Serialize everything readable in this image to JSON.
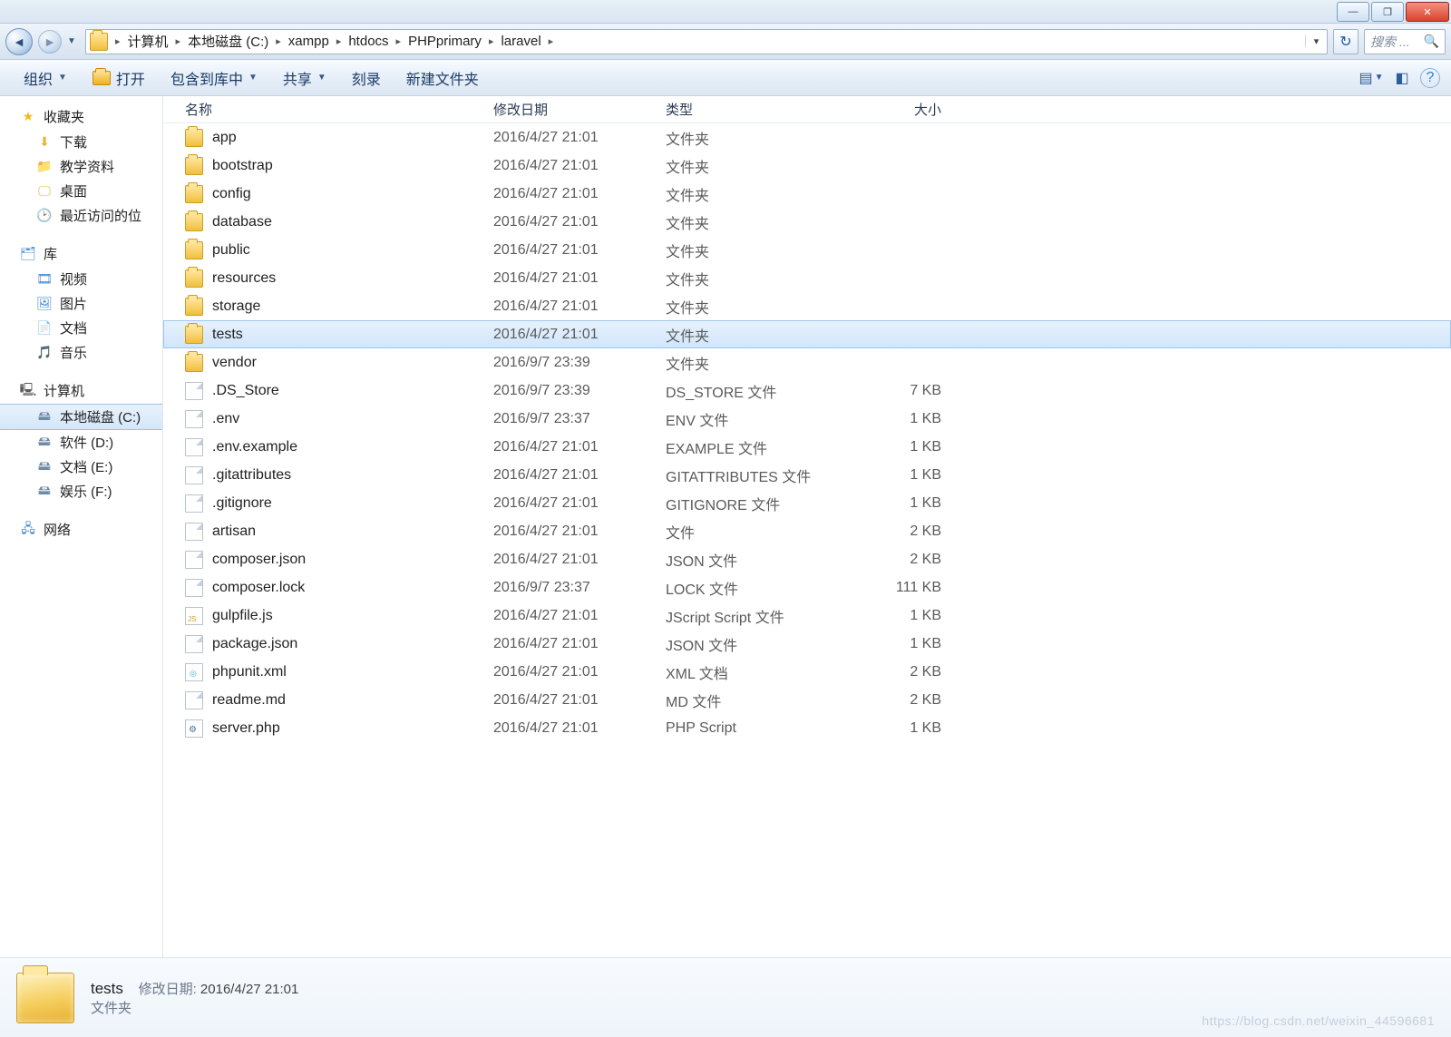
{
  "titlebar": {
    "min": "—",
    "max": "❐",
    "close": "✕"
  },
  "address": {
    "back": "◄",
    "fwd": "►",
    "history_drop": "▼",
    "crumbs": [
      "计算机",
      "本地磁盘 (C:)",
      "xampp",
      "htdocs",
      "PHPprimary",
      "laravel"
    ],
    "sep": "▸",
    "path_drop": "▾",
    "refresh": "↻",
    "search_placeholder": "搜索 ...",
    "search_icon": "🔍"
  },
  "toolbar": {
    "organize": "组织",
    "open": "打开",
    "include": "包含到库中",
    "share": "共享",
    "burn": "刻录",
    "newfolder": "新建文件夹",
    "view_icon": "▤",
    "preview_icon": "◧",
    "help_icon": "?"
  },
  "nav": {
    "favorites": "收藏夹",
    "fav_items": [
      "下载",
      "教学资料",
      "桌面",
      "最近访问的位"
    ],
    "libraries": "库",
    "lib_items": [
      "视频",
      "图片",
      "文档",
      "音乐"
    ],
    "computer": "计算机",
    "drives": [
      "本地磁盘 (C:)",
      "软件 (D:)",
      "文档 (E:)",
      "娱乐 (F:)"
    ],
    "selected_drive_index": 0,
    "network": "网络"
  },
  "columns": {
    "name": "名称",
    "date": "修改日期",
    "type": "类型",
    "size": "大小"
  },
  "files": [
    {
      "name": "app",
      "date": "2016/4/27 21:01",
      "type": "文件夹",
      "size": "",
      "icon": "folder"
    },
    {
      "name": "bootstrap",
      "date": "2016/4/27 21:01",
      "type": "文件夹",
      "size": "",
      "icon": "folder"
    },
    {
      "name": "config",
      "date": "2016/4/27 21:01",
      "type": "文件夹",
      "size": "",
      "icon": "folder"
    },
    {
      "name": "database",
      "date": "2016/4/27 21:01",
      "type": "文件夹",
      "size": "",
      "icon": "folder"
    },
    {
      "name": "public",
      "date": "2016/4/27 21:01",
      "type": "文件夹",
      "size": "",
      "icon": "folder"
    },
    {
      "name": "resources",
      "date": "2016/4/27 21:01",
      "type": "文件夹",
      "size": "",
      "icon": "folder"
    },
    {
      "name": "storage",
      "date": "2016/4/27 21:01",
      "type": "文件夹",
      "size": "",
      "icon": "folder"
    },
    {
      "name": "tests",
      "date": "2016/4/27 21:01",
      "type": "文件夹",
      "size": "",
      "icon": "folder",
      "selected": true
    },
    {
      "name": "vendor",
      "date": "2016/9/7 23:39",
      "type": "文件夹",
      "size": "",
      "icon": "folder"
    },
    {
      "name": ".DS_Store",
      "date": "2016/9/7 23:39",
      "type": "DS_STORE 文件",
      "size": "7 KB",
      "icon": "file"
    },
    {
      "name": ".env",
      "date": "2016/9/7 23:37",
      "type": "ENV 文件",
      "size": "1 KB",
      "icon": "file"
    },
    {
      "name": ".env.example",
      "date": "2016/4/27 21:01",
      "type": "EXAMPLE 文件",
      "size": "1 KB",
      "icon": "file"
    },
    {
      "name": ".gitattributes",
      "date": "2016/4/27 21:01",
      "type": "GITATTRIBUTES 文件",
      "size": "1 KB",
      "icon": "file"
    },
    {
      "name": ".gitignore",
      "date": "2016/4/27 21:01",
      "type": "GITIGNORE 文件",
      "size": "1 KB",
      "icon": "file"
    },
    {
      "name": "artisan",
      "date": "2016/4/27 21:01",
      "type": "文件",
      "size": "2 KB",
      "icon": "file"
    },
    {
      "name": "composer.json",
      "date": "2016/4/27 21:01",
      "type": "JSON 文件",
      "size": "2 KB",
      "icon": "file"
    },
    {
      "name": "composer.lock",
      "date": "2016/9/7 23:37",
      "type": "LOCK 文件",
      "size": "111 KB",
      "icon": "file"
    },
    {
      "name": "gulpfile.js",
      "date": "2016/4/27 21:01",
      "type": "JScript Script 文件",
      "size": "1 KB",
      "icon": "js"
    },
    {
      "name": "package.json",
      "date": "2016/4/27 21:01",
      "type": "JSON 文件",
      "size": "1 KB",
      "icon": "file"
    },
    {
      "name": "phpunit.xml",
      "date": "2016/4/27 21:01",
      "type": "XML 文档",
      "size": "2 KB",
      "icon": "xml"
    },
    {
      "name": "readme.md",
      "date": "2016/4/27 21:01",
      "type": "MD 文件",
      "size": "2 KB",
      "icon": "file"
    },
    {
      "name": "server.php",
      "date": "2016/4/27 21:01",
      "type": "PHP Script",
      "size": "1 KB",
      "icon": "php"
    }
  ],
  "details": {
    "name": "tests",
    "date_label": "修改日期:",
    "date": "2016/4/27 21:01",
    "type": "文件夹"
  },
  "watermark": "https://blog.csdn.net/weixin_44596681"
}
